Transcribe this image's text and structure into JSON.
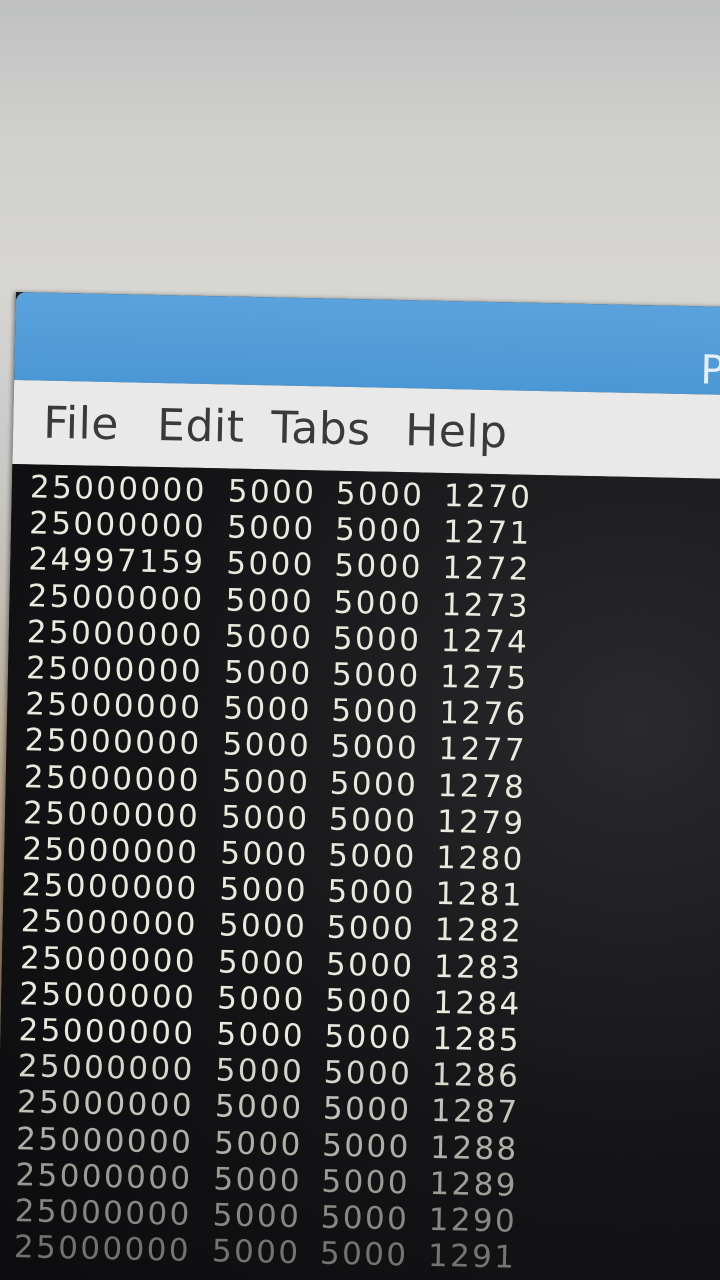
{
  "window": {
    "title_fragment": "P"
  },
  "menu": {
    "items": [
      {
        "id": "file",
        "label": "File"
      },
      {
        "id": "edit",
        "label": "Edit"
      },
      {
        "id": "tabs",
        "label": "Tabs"
      },
      {
        "id": "help",
        "label": "Help"
      }
    ]
  },
  "terminal": {
    "rows": [
      [
        "25000000",
        "5000",
        "5000",
        "1270"
      ],
      [
        "25000000",
        "5000",
        "5000",
        "1271"
      ],
      [
        "24997159",
        "5000",
        "5000",
        "1272"
      ],
      [
        "25000000",
        "5000",
        "5000",
        "1273"
      ],
      [
        "25000000",
        "5000",
        "5000",
        "1274"
      ],
      [
        "25000000",
        "5000",
        "5000",
        "1275"
      ],
      [
        "25000000",
        "5000",
        "5000",
        "1276"
      ],
      [
        "25000000",
        "5000",
        "5000",
        "1277"
      ],
      [
        "25000000",
        "5000",
        "5000",
        "1278"
      ],
      [
        "25000000",
        "5000",
        "5000",
        "1279"
      ],
      [
        "25000000",
        "5000",
        "5000",
        "1280"
      ],
      [
        "25000000",
        "5000",
        "5000",
        "1281"
      ],
      [
        "25000000",
        "5000",
        "5000",
        "1282"
      ],
      [
        "25000000",
        "5000",
        "5000",
        "1283"
      ],
      [
        "25000000",
        "5000",
        "5000",
        "1284"
      ],
      [
        "25000000",
        "5000",
        "5000",
        "1285"
      ],
      [
        "25000000",
        "5000",
        "5000",
        "1286"
      ],
      [
        "25000000",
        "5000",
        "5000",
        "1287"
      ],
      [
        "25000000",
        "5000",
        "5000",
        "1288"
      ],
      [
        "25000000",
        "5000",
        "5000",
        "1289"
      ],
      [
        "25000000",
        "5000",
        "5000",
        "1290"
      ],
      [
        "25000000",
        "5000",
        "5000",
        "1291"
      ]
    ]
  }
}
